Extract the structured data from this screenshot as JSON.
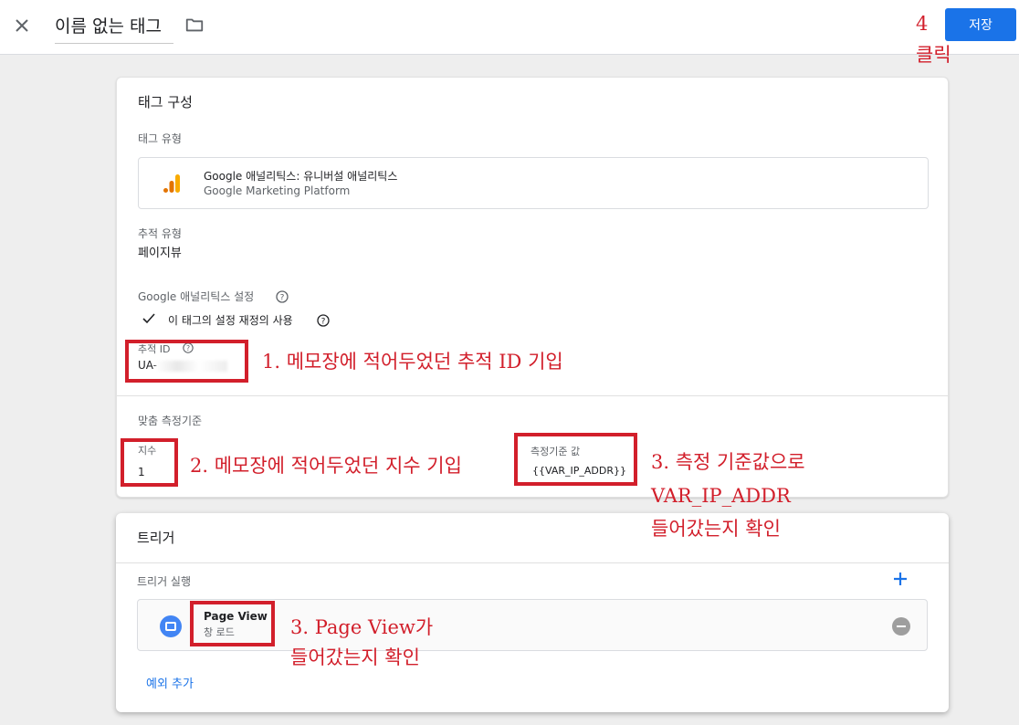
{
  "header": {
    "tag_name": "이름 없는 태그",
    "save_label": "저장"
  },
  "config": {
    "title": "태그 구성",
    "tag_type_label": "태그 유형",
    "tag_type_name": "Google 애널리틱스: 유니버설 애널리틱스",
    "tag_type_sub": "Google Marketing Platform",
    "track_type_label": "추적 유형",
    "track_type_value": "페이지뷰",
    "ga_settings_label": "Google 애널리틱스 설정",
    "override_label": "이 태그의 설정 재정의 사용",
    "tracking_id_label": "추적 ID",
    "tracking_id_value": "UA-",
    "custom_metrics_label": "맞춤 측정기준",
    "index_label": "지수",
    "index_value": "1",
    "dimension_value_label": "측정기준 값",
    "dimension_value": "{{VAR_IP_ADDR}}"
  },
  "triggers": {
    "title": "트리거",
    "firing_label": "트리거 실행",
    "items": [
      {
        "name": "Page View",
        "sub": "창 로드"
      }
    ],
    "add_exception_label": "예외 추가"
  },
  "annotations": {
    "a1": "1. 메모장에 적어두었던 추적 ID 기입",
    "a2": "2. 메모장에 적어두었던 지수 기입",
    "a3_line1": "3. 측정 기준값으로",
    "a3_line2": "VAR_IP_ADDR",
    "a3_line3": "들어갔는지 확인",
    "a4_line1": "3. Page View가",
    "a4_line2": "들어갔는지 확인",
    "save_num": "4",
    "save_click": "클릭"
  },
  "colors": {
    "accent": "#1a73e8",
    "annotation_red": "#d21f2b",
    "ga_orange": "#f9ab00",
    "ga_dark_orange": "#e37400"
  },
  "icons": [
    "close-icon",
    "folder-icon",
    "google-analytics-icon",
    "help-icon",
    "checkmark-icon",
    "trigger-pageview-icon",
    "remove-icon",
    "add-icon"
  ]
}
